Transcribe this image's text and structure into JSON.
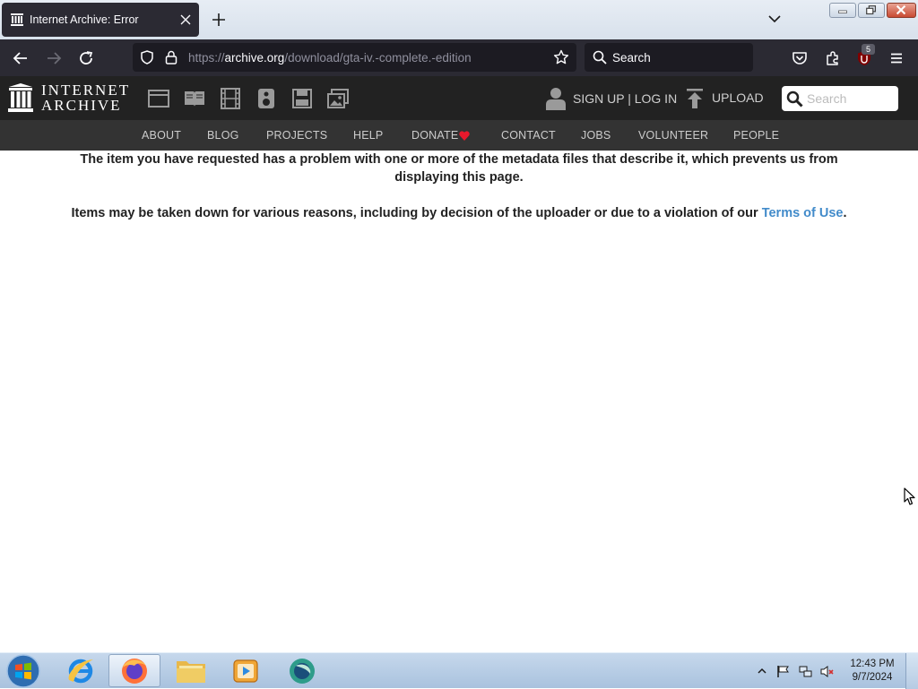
{
  "browser": {
    "tab_title": "Internet Archive: Error",
    "url_scheme": "https://",
    "url_host": "archive.org",
    "url_path": "/download/gta-iv.-complete.-edition",
    "search_label": "Search",
    "extension_badge": "5"
  },
  "ia": {
    "logo_line1": "INTERNET",
    "logo_line2": "ARCHIVE",
    "signup_login": "SIGN UP | LOG IN",
    "upload": "UPLOAD",
    "search_placeholder": "Search",
    "nav": [
      "ABOUT",
      "BLOG",
      "PROJECTS",
      "HELP",
      "DONATE",
      "CONTACT",
      "JOBS",
      "VOLUNTEER",
      "PEOPLE"
    ]
  },
  "content": {
    "message1": "The item you have requested has a problem with one or more of the metadata files that describe it, which prevents us from displaying this page.",
    "message2_prefix": "Items may be taken down for various reasons, including by decision of the uploader or due to a violation of our ",
    "terms_link": "Terms of Use",
    "message2_suffix": "."
  },
  "taskbar": {
    "time": "12:43 PM",
    "date": "9/7/2024"
  },
  "colors": {
    "ia_header": "#222222",
    "ia_nav": "#333333",
    "link": "#428bca",
    "donate_heart": "#e8192c"
  }
}
